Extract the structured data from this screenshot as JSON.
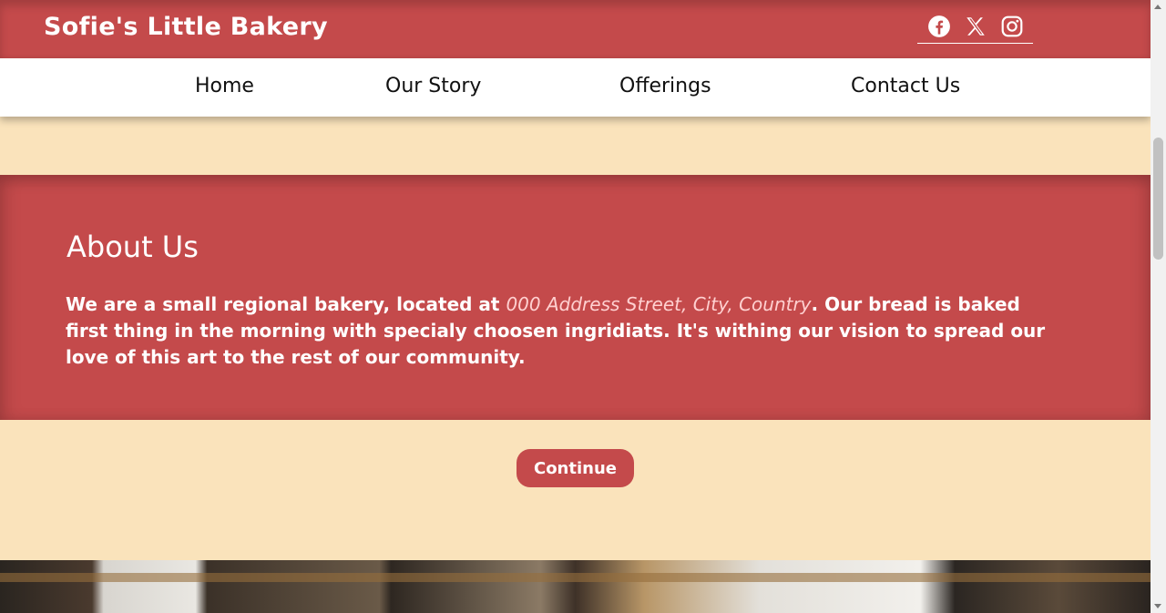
{
  "header": {
    "brand": "Sofie's Little Bakery",
    "social_icons": [
      "facebook-icon",
      "x-icon",
      "instagram-icon"
    ]
  },
  "nav": {
    "items": [
      "Home",
      "Our Story",
      "Offerings",
      "Contact Us"
    ]
  },
  "about": {
    "title": "About Us",
    "text_before": "We are a small regional bakery, located at ",
    "address": "000 Address Street, City, Country",
    "text_after": ". Our bread is baked first thing in the morning with specialy choosen ingridiats. It's withing our vision to spread our love of this art to the rest of our community."
  },
  "continue_label": "Continue",
  "colors": {
    "primary": "#c44a4b",
    "background": "#fae3bb",
    "nav_bg": "#ffffff"
  }
}
